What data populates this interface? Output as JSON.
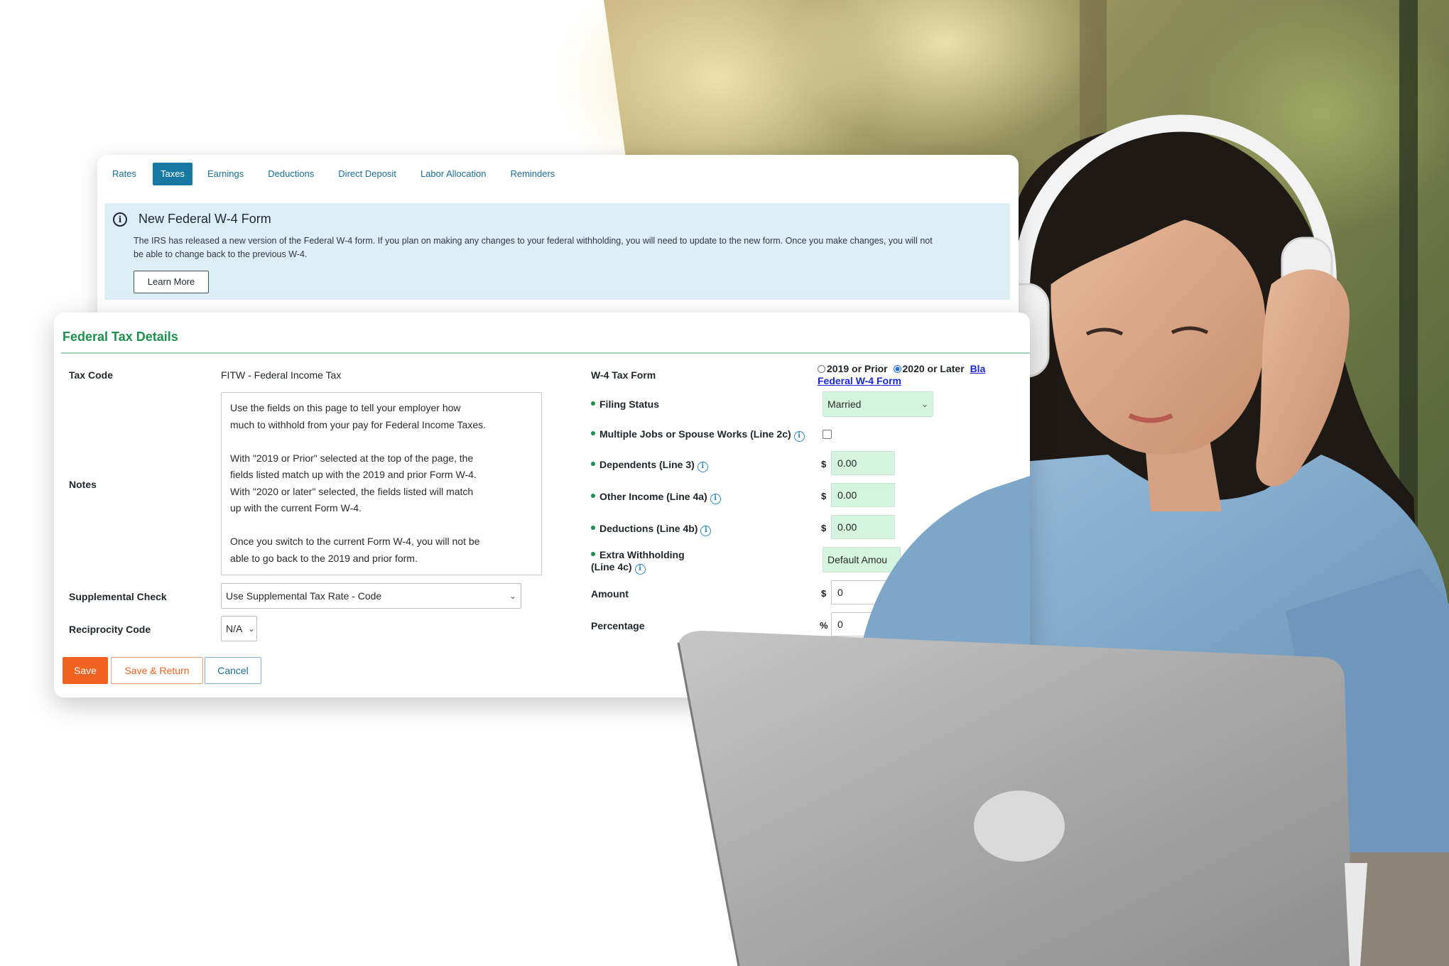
{
  "tabs": [
    "Rates",
    "Taxes",
    "Earnings",
    "Deductions",
    "Direct Deposit",
    "Labor Allocation",
    "Reminders"
  ],
  "active_tab": "Taxes",
  "notice": {
    "title": "New Federal W-4 Form",
    "text": "The IRS has released a new version of the Federal W-4 form. If you plan on making any changes to your federal withholding, you will need to update to the new form. Once you make changes, you will not be able to change back to the previous W-4.",
    "learn_more": "Learn More"
  },
  "form": {
    "title": "Federal Tax Details",
    "tax_code_label": "Tax Code",
    "tax_code_value": "FITW - Federal Income Tax",
    "notes_label": "Notes",
    "notes_paragraphs": [
      "Use the fields on this page to tell your employer how much to withhold from your pay for Federal Income Taxes.",
      "With \"2019 or Prior\" selected at the top of the page, the fields listed match up with the 2019 and prior Form W-4.  With \"2020 or later\" selected, the fields listed will match up with the current Form W-4.",
      "Once you switch to the current Form W-4, you will not be able to go back to the 2019 and prior form."
    ],
    "supplemental_label": "Supplemental Check",
    "supplemental_value": "Use Supplemental Tax Rate - Code",
    "reciprocity_label": "Reciprocity Code",
    "reciprocity_value": "N/A",
    "w4_label": "W-4 Tax Form",
    "radio_2019": "2019 or Prior",
    "radio_2020": "2020 or Later",
    "radio_selected": "2020 or Later",
    "blank_link_fragment": "Bla",
    "federal_w4_link": "Federal W-4 Form",
    "filing_status_label": "Filing Status",
    "filing_status_value": "Married",
    "multiple_jobs_label": "Multiple Jobs or Spouse Works (Line 2c)",
    "multiple_jobs_checked": false,
    "dependents_label": "Dependents (Line 3)",
    "dependents_value": "0.00",
    "other_income_label": "Other Income (Line 4a)",
    "other_income_value": "0.00",
    "deductions_label": "Deductions (Line 4b)",
    "deductions_value": "0.00",
    "extra_withholding_label_1": "Extra Withholding",
    "extra_withholding_label_2": "(Line 4c)",
    "extra_withholding_value": "Default Amou",
    "amount_label": "Amount",
    "amount_value": "0",
    "percentage_label": "Percentage",
    "percentage_value": "0",
    "currency_symbol": "$",
    "percent_symbol": "%",
    "save": "Save",
    "save_return": "Save & Return",
    "cancel": "Cancel"
  },
  "colors": {
    "accent_orange": "#f0621f",
    "accent_green": "#1f8f4e",
    "tab_blue": "#1779a2",
    "notice_bg": "#ddeff4"
  }
}
